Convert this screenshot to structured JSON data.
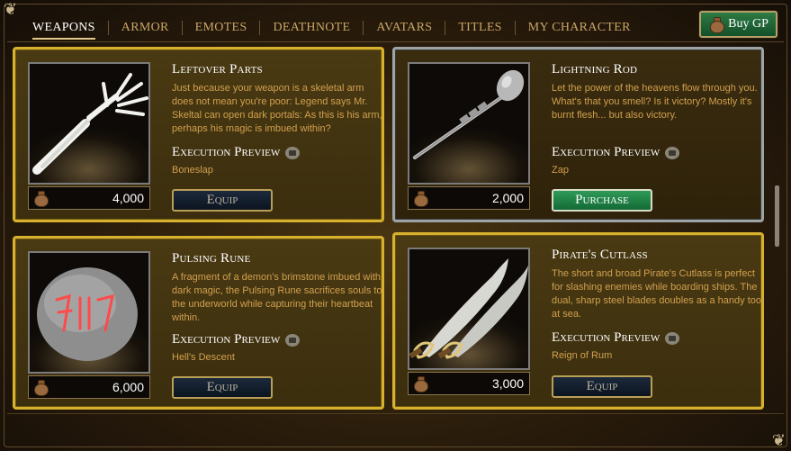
{
  "nav": {
    "tabs": [
      {
        "label": "WEAPONS",
        "active": true
      },
      {
        "label": "ARMOR"
      },
      {
        "label": "EMOTES"
      },
      {
        "label": "DEATHNOTE"
      },
      {
        "label": "AVATARS"
      },
      {
        "label": "TITLES"
      },
      {
        "label": "MY CHARACTER"
      }
    ],
    "buy_gp_label": "Buy GP"
  },
  "items": [
    {
      "title": "Leftover Parts",
      "description": "Just because your weapon is a skeletal arm does not mean you're poor: Legend says Mr. Skeltal can open dark portals: As this is his arm, perhaps his magic is imbued within?",
      "execution_label": "Execution Preview",
      "execution_name": "Boneslap",
      "price": "4,000",
      "action": "Equip",
      "icon": "skeletal-arm-icon",
      "frame_color": "#d7b12d"
    },
    {
      "title": "Lightning Rod",
      "description": "Let the power of the heavens flow through you. What's that you smell? Is it victory? Mostly it's burnt flesh... but also victory.",
      "execution_label": "Execution Preview",
      "execution_name": "Zap",
      "price": "2,000",
      "action": "Purchase",
      "icon": "lightning-rod-icon",
      "frame_color": "#9ea4a6"
    },
    {
      "title": "Pulsing Rune",
      "description": "A fragment of a demon's brimstone imbued with dark magic, the Pulsing Rune sacrifices souls to the underworld while capturing their heartbeat within.",
      "execution_label": "Execution Preview",
      "execution_name": "Hell's Descent",
      "price": "6,000",
      "action": "Equip",
      "icon": "rune-stone-icon",
      "frame_color": "#d7b12d"
    },
    {
      "title": "Pirate's Cutlass",
      "description": "The short and broad Pirate's Cutlass is perfect for slashing enemies while boarding ships. The dual, sharp steel blades doubles as a handy tool at sea.",
      "execution_label": "Execution Preview",
      "execution_name": "Reign of Rum",
      "price": "3,000",
      "action": "Equip",
      "icon": "cutlass-icon",
      "frame_color": "#d7b12d"
    }
  ],
  "colors": {
    "gold_frame": "#d7b12d",
    "silver_frame": "#9ea4a6",
    "description_text": "#d1a04e",
    "purchase_button": "#2f9a58",
    "equip_button": "#1c2a3c"
  }
}
